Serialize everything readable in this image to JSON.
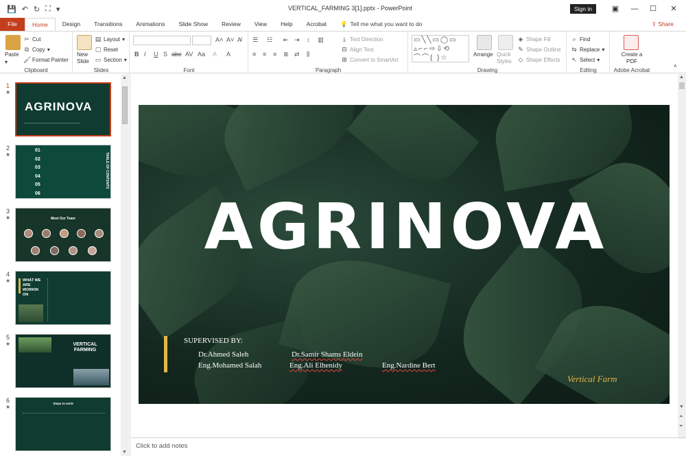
{
  "window": {
    "title": "VERTICAL_FARMING 3[1].pptx  -  PowerPoint",
    "sign_in": "Sign in",
    "controls": [
      "—",
      "☐",
      "✕"
    ]
  },
  "tabs": [
    "File",
    "Home",
    "Design",
    "Transitions",
    "Animations",
    "Slide Show",
    "Review",
    "View",
    "Help",
    "Acrobat"
  ],
  "active_tab": "Home",
  "tell_me": "Tell me what you want to do",
  "share": "Share",
  "ribbon": {
    "clipboard": {
      "label": "Clipboard",
      "paste": "Paste",
      "cut": "Cut",
      "copy": "Copy",
      "format_painter": "Format Painter"
    },
    "slides": {
      "label": "Slides",
      "new_slide": "New Slide",
      "layout": "Layout",
      "reset": "Reset",
      "section": "Section"
    },
    "font": {
      "label": "Font"
    },
    "paragraph": {
      "label": "Paragraph",
      "text_direction": "Text Direction",
      "align_text": "Align Text",
      "convert_smartart": "Convert to SmartArt"
    },
    "drawing": {
      "label": "Drawing",
      "arrange": "Arrange",
      "quick_styles": "Quick Styles",
      "shape_fill": "Shape Fill",
      "shape_outline": "Shape Outline",
      "shape_effects": "Shape Effects"
    },
    "editing": {
      "label": "Editing",
      "find": "Find",
      "replace": "Replace",
      "select": "Select"
    },
    "acrobat": {
      "label": "Adobe Acrobat",
      "create_pdf": "Create a PDF"
    }
  },
  "thumbnails": [
    {
      "num": "1",
      "title": "AGRINOVA"
    },
    {
      "num": "2",
      "items": [
        "01",
        "02",
        "03",
        "04",
        "05",
        "06"
      ],
      "side": "TABLE OF CONTENTS"
    },
    {
      "num": "3",
      "title": "Meet Our Team"
    },
    {
      "num": "4",
      "title": "WHAT WE ARE WORKIN ON"
    },
    {
      "num": "5",
      "title": "VERTICAL FARMING"
    },
    {
      "num": "6",
      "title": "Steps to work"
    }
  ],
  "slide": {
    "title": "AGRINOVA",
    "supervised_by": "SUPERVISED BY:",
    "names": {
      "n1": "Dr.Ahmed Saleh",
      "n2": "Dr.Samir Shams Eldein",
      "n3": "Eng.Mohamed Salah",
      "n4": "Eng.Ali Elhenidy",
      "n5": "Eng.Nardine Bert"
    },
    "tagline": "Vertical Farm"
  },
  "notes_placeholder": "Click to add notes",
  "colors": {
    "accent": "#c43e1c",
    "slide_bg": "#14281f",
    "gold": "#e5b64a"
  }
}
